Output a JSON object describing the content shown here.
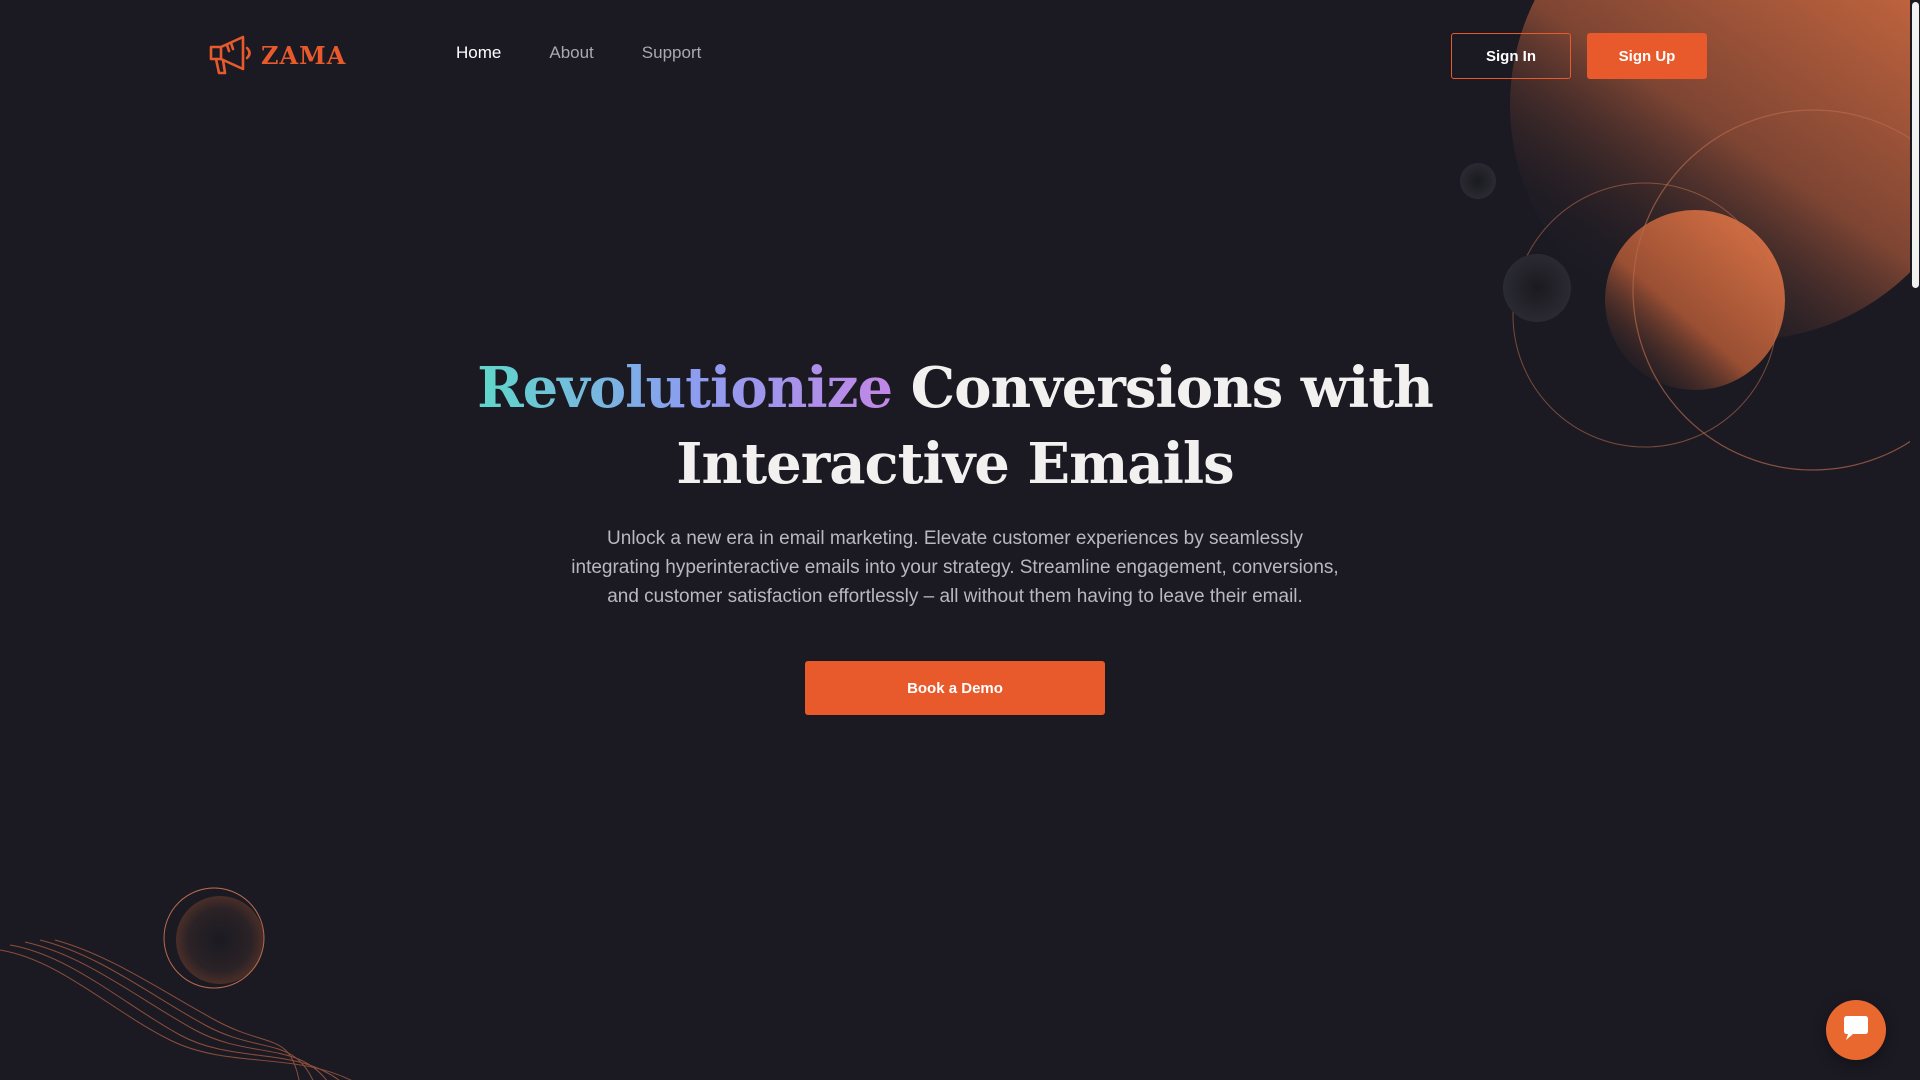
{
  "brand": {
    "name": "ZAMA",
    "logo_icon": "megaphone-icon",
    "accent_color": "#e85a2b",
    "background_color": "#1b1a23"
  },
  "nav": {
    "items": [
      {
        "label": "Home",
        "active": true
      },
      {
        "label": "About",
        "active": false
      },
      {
        "label": "Support",
        "active": false
      }
    ]
  },
  "auth": {
    "sign_in_label": "Sign In",
    "sign_up_label": "Sign Up"
  },
  "hero": {
    "title_highlight": "Revolutionize",
    "title_rest_line1": " Conversions with",
    "title_line2": "Interactive Emails",
    "subtitle": "Unlock a new era in email marketing. Elevate customer experiences by seamlessly integrating hyperinteractive emails into your strategy. Streamline engagement, conversions, and customer satisfaction effortlessly – all without them having to leave their email.",
    "cta_label": "Book a Demo",
    "gradient_colors": [
      "#5fd8c9",
      "#8a9ef0",
      "#c287e6"
    ]
  },
  "chat": {
    "icon": "chat-bubble-icon"
  }
}
